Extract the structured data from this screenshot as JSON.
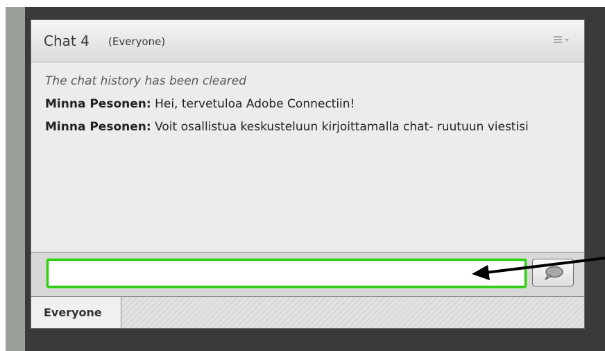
{
  "chat": {
    "title": "Chat 4",
    "audience": "(Everyone)",
    "messages": {
      "system_notice": "The chat history has been cleared",
      "m1": {
        "sender": "Minna Pesonen:",
        "text": " Hei, tervetuloa Adobe Connectiin!"
      },
      "m2": {
        "sender": "Minna Pesonen:",
        "text": " Voit osallistua keskusteluun kirjoittamalla chat- ruutuun viestisi"
      }
    },
    "input": {
      "value": ""
    },
    "tabs": {
      "everyone": "Everyone"
    }
  },
  "icons": {
    "menu": "pod-menu-icon",
    "send": "speech-bubble-icon"
  },
  "colors": {
    "input_border": "#36cc1c",
    "arrow": "#000000"
  }
}
